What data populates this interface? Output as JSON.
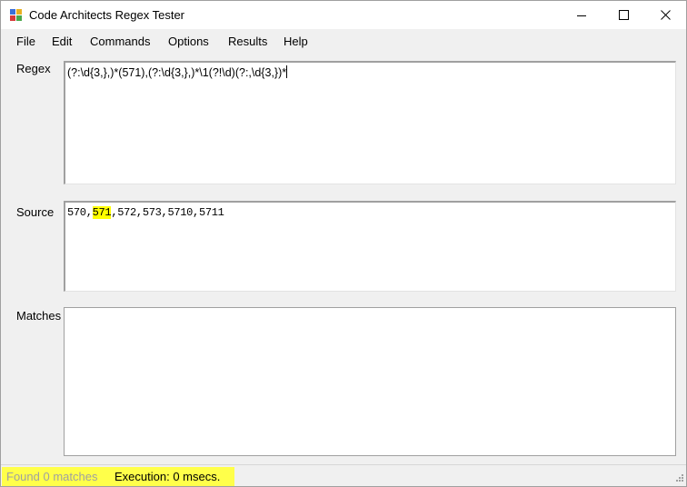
{
  "window": {
    "title": "Code Architects Regex Tester"
  },
  "menu": {
    "items": [
      "File",
      "Edit",
      "Commands",
      "Options",
      "Results",
      "Help"
    ]
  },
  "regex": {
    "label": "Regex",
    "value": "(?:\\d{3,},)*(571),(?:\\d{3,},)*\\1(?!\\d)(?:,\\d{3,})*"
  },
  "source": {
    "label": "Source",
    "before_highlight": "570,",
    "highlighted": "571",
    "after_highlight": ",572,573,5710,5711",
    "highlight_color": "#ffff00"
  },
  "matches": {
    "label": "Matches"
  },
  "status": {
    "found": "Found 0 matches",
    "execution": "Execution: 0 msecs.",
    "highlight_color": "#ffff4a"
  }
}
